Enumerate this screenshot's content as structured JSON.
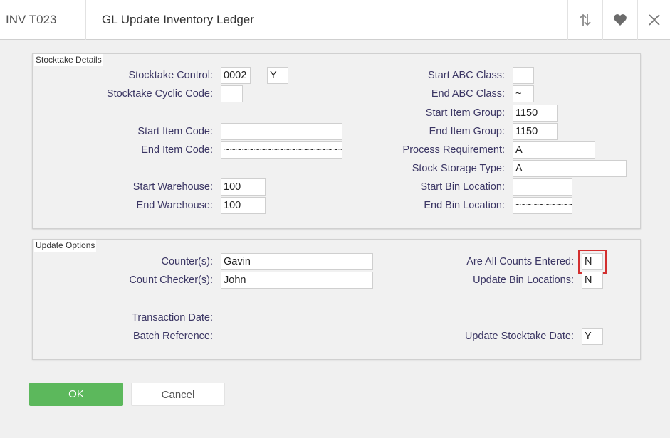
{
  "header": {
    "code": "INV T023",
    "title": "GL Update Inventory Ledger"
  },
  "stocktake": {
    "legend": "Stocktake Details",
    "stocktake_control_label": "Stocktake Control:",
    "stocktake_control_value": "0002",
    "stocktake_control_flag": "Y",
    "cyclic_code_label": "Stocktake Cyclic Code:",
    "cyclic_code_value": "",
    "start_item_code_label": "Start Item Code:",
    "start_item_code_value": "",
    "end_item_code_label": "End Item Code:",
    "end_item_code_value": "~~~~~~~~~~~~~~~~~~~~",
    "start_warehouse_label": "Start Warehouse:",
    "start_warehouse_value": "100",
    "end_warehouse_label": "End Warehouse:",
    "end_warehouse_value": "100",
    "start_abc_label": "Start ABC Class:",
    "start_abc_value": "",
    "end_abc_label": "End ABC Class:",
    "end_abc_value": "~",
    "start_item_group_label": "Start Item Group:",
    "start_item_group_value": "1150",
    "end_item_group_label": "End Item Group:",
    "end_item_group_value": "1150",
    "process_req_label": "Process Requirement:",
    "process_req_value": "A",
    "storage_type_label": "Stock Storage Type:",
    "storage_type_value": "A",
    "start_bin_label": "Start Bin Location:",
    "start_bin_value": "",
    "end_bin_label": "End Bin Location:",
    "end_bin_value": "~~~~~~~~~~"
  },
  "update": {
    "legend": "Update Options",
    "counters_label": "Counter(s):",
    "counters_value": "Gavin",
    "checkers_label": "Count Checker(s):",
    "checkers_value": "John",
    "transaction_date_label": "Transaction Date:",
    "batch_ref_label": "Batch Reference:",
    "all_counts_label": "Are All Counts Entered:",
    "all_counts_value": "N",
    "update_bin_label": "Update Bin Locations:",
    "update_bin_value": "N",
    "update_stocktake_date_label": "Update Stocktake Date:",
    "update_stocktake_date_value": "Y"
  },
  "buttons": {
    "ok": "OK",
    "cancel": "Cancel"
  },
  "colors": {
    "ok": "#5cb85c",
    "highlight": "#d32f2f",
    "label": "#3b3664"
  }
}
